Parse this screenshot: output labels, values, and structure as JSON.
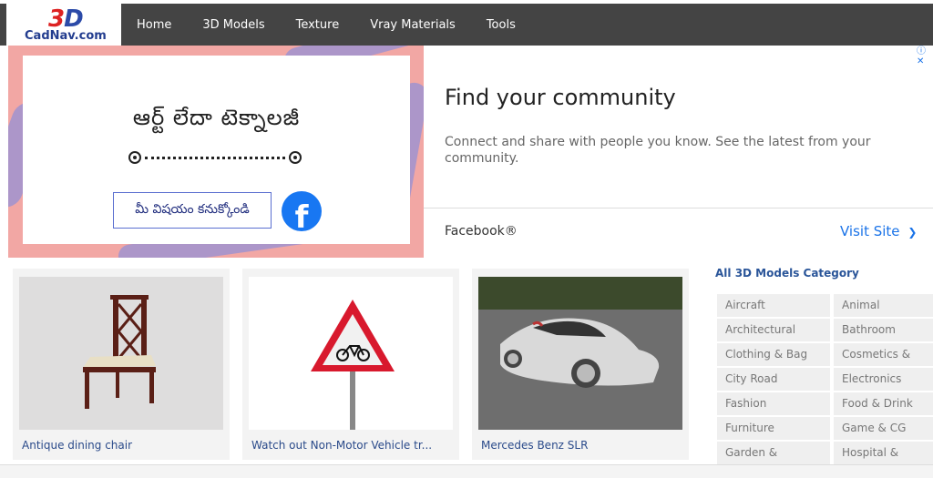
{
  "logo": {
    "mark": "3D",
    "text": "CadNav.com"
  },
  "nav": {
    "items": [
      "Home",
      "3D Models",
      "Texture",
      "Vray Materials",
      "Tools"
    ]
  },
  "ad": {
    "telugu_title": "ఆర్ట్     లేదా  టెక్నాలజీ",
    "telugu_button": "మీ విషయం కనుక్కోండి",
    "fb_logo_letter": "f",
    "headline": "Find your community",
    "description": "Connect and share with people you know. See the latest from your community.",
    "brand": "Facebook®",
    "visit": "Visit Site",
    "visit_chevron": "❯",
    "info": "ⓘ ✕",
    "colors": {
      "left_bg": "#f2a7a4",
      "fb_blue": "#1877f2",
      "link": "#1a73e8"
    }
  },
  "models": [
    {
      "title": "Antique dining chair",
      "icon": "chair-thumbnail"
    },
    {
      "title": "Watch out Non-Motor Vehicle tr...",
      "icon": "bicycle-warning-sign-thumbnail"
    },
    {
      "title": "Mercedes Benz SLR",
      "icon": "car-thumbnail"
    }
  ],
  "categories": {
    "title": "All 3D Models Category",
    "items": [
      "Aircraft",
      "Animal",
      "Architectural",
      "Bathroom",
      "Clothing & Bag",
      "Cosmetics &",
      "City Road",
      "Electronics",
      "Fashion",
      "Food & Drink",
      "Furniture",
      "Game & CG",
      "Garden &",
      "Hospital &"
    ]
  }
}
